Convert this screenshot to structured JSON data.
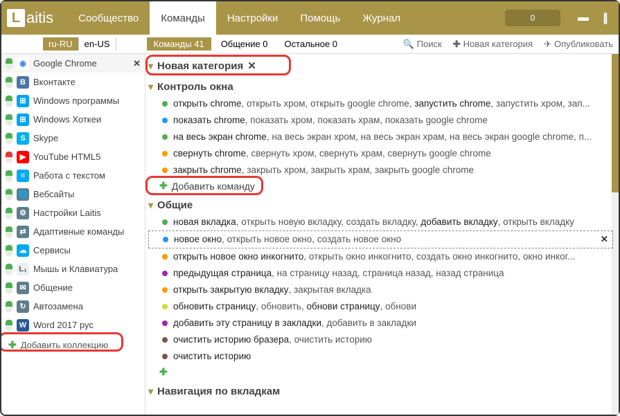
{
  "app": {
    "logo_letter": "L",
    "logo_text": "aitis",
    "pill": "0"
  },
  "nav": [
    {
      "label": "Сообщество",
      "active": false
    },
    {
      "label": "Команды",
      "active": true
    },
    {
      "label": "Настройки",
      "active": false
    },
    {
      "label": "Помощь",
      "active": false
    },
    {
      "label": "Журнал",
      "active": false
    }
  ],
  "langs": [
    {
      "code": "ru-RU",
      "active": true
    },
    {
      "code": "en-US",
      "active": false
    }
  ],
  "filter_tabs": [
    {
      "label": "Команды",
      "count": "41",
      "active": true
    },
    {
      "label": "Общение",
      "count": "0",
      "active": false
    },
    {
      "label": "Остальное",
      "count": "0",
      "active": false
    }
  ],
  "toolbar": {
    "search": "Поиск",
    "new_category": "Новая категория",
    "publish": "Опубликовать"
  },
  "sidebar": [
    {
      "label": "Google Chrome",
      "icon_bg": "#fff",
      "icon_txt": "◉",
      "icon_fg": "#4285f4",
      "tg": "tg-green",
      "active": true,
      "close": true
    },
    {
      "label": "Вконтакте",
      "icon_bg": "#4a76a8",
      "icon_txt": "B",
      "tg": "tg-green"
    },
    {
      "label": "Windows программы",
      "icon_bg": "#00a4ef",
      "icon_txt": "⊞",
      "tg": "tg-green"
    },
    {
      "label": "Windows Хоткеи",
      "icon_bg": "#00a4ef",
      "icon_txt": "⊞",
      "tg": "tg-green"
    },
    {
      "label": "Skype",
      "icon_bg": "#00aff0",
      "icon_txt": "S",
      "tg": "tg-green"
    },
    {
      "label": "YouTube HTML5",
      "icon_bg": "#ff0000",
      "icon_txt": "▶",
      "tg": "tg-red"
    },
    {
      "label": "Работа с текстом",
      "icon_bg": "#03a9f4",
      "icon_txt": "≡",
      "tg": "tg-green"
    },
    {
      "label": "Вебсайты",
      "icon_bg": "#607d8b",
      "icon_txt": "🌐",
      "tg": "tg-green"
    },
    {
      "label": "Настройки Laitis",
      "icon_bg": "#607d8b",
      "icon_txt": "⚙",
      "tg": "tg-green"
    },
    {
      "label": "Адаптивные команды",
      "icon_bg": "#607d8b",
      "icon_txt": "⇄",
      "tg": "tg-green"
    },
    {
      "label": "Сервисы",
      "icon_bg": "#03a9f4",
      "icon_txt": "☁",
      "tg": "tg-green"
    },
    {
      "label": "Мышь и Клавиатура",
      "icon_bg": "#eceff1",
      "icon_txt": "L₁",
      "icon_fg": "#555",
      "tg": "tg-green"
    },
    {
      "label": "Общение",
      "icon_bg": "#607d8b",
      "icon_txt": "✉",
      "tg": "tg-green"
    },
    {
      "label": "Автозамена",
      "icon_bg": "#607d8b",
      "icon_txt": "↻",
      "tg": "tg-green"
    },
    {
      "label": "Word 2017 рус",
      "icon_bg": "#2b579a",
      "icon_txt": "W",
      "tg": "tg-green"
    }
  ],
  "sidebar_add": "Добавить коллекцию",
  "sections": {
    "new_cat": "Новая категория",
    "win_ctrl": {
      "title": "Контроль окна",
      "rows": [
        {
          "dot": "d-g",
          "parts": [
            "открыть chrome",
            ", открыть хром, открыть google chrome, ",
            "запустить chrome",
            ", запустить хром, зап..."
          ]
        },
        {
          "dot": "d-b",
          "parts": [
            "показать chrome",
            ", показать хром, показать храм, показать google chrome"
          ]
        },
        {
          "dot": "d-g",
          "parts": [
            "на весь экран chrome",
            ", на весь экран хром, на весь экран храм, на весь экран google chrome, п..."
          ]
        },
        {
          "dot": "d-o",
          "parts": [
            "свернуть chrome",
            ", свернуть хром, свернуть храм, свернуть google chrome"
          ]
        },
        {
          "dot": "d-o",
          "parts": [
            "закрыть chrome",
            ", закрыть хром, закрыть храм, закрыть google chrome"
          ]
        }
      ],
      "add": "Добавить команду"
    },
    "common": {
      "title": "Общие",
      "rows": [
        {
          "dot": "d-g",
          "parts": [
            "новая вкладка",
            ", открыть новую вкладку, создать вкладку, ",
            "добавить вкладку",
            ", открыть вкладку"
          ]
        },
        {
          "dot": "d-b",
          "sel": true,
          "parts": [
            "новое окно",
            ", открыть новое окно, создать новое окно"
          ]
        },
        {
          "dot": "d-o",
          "parts": [
            "открыть новое окно инкогнито",
            ", открыть окно инкогнито, создать окно инкогнито, окно инког..."
          ]
        },
        {
          "dot": "d-p",
          "parts": [
            "предыдущая страница",
            ", на страницу назад, страница назад, назад страница"
          ]
        },
        {
          "dot": "d-o",
          "parts": [
            "открыть закрытую вкладку",
            ", закрытая вкладка"
          ]
        },
        {
          "dot": "d-y",
          "parts": [
            "обновить страницу",
            ", обновить, ",
            "обнови страницу",
            ", обнови"
          ]
        },
        {
          "dot": "d-p",
          "parts": [
            "добавить эту страницу в закладки",
            ", добавить в закладки"
          ]
        },
        {
          "dot": "d-br",
          "parts": [
            "очистить историю бразера",
            ", очистить историю"
          ]
        },
        {
          "dot": "d-br",
          "parts": [
            "очистить историю"
          ]
        }
      ]
    },
    "nav_tabs": "Навигация по вкладкам"
  }
}
